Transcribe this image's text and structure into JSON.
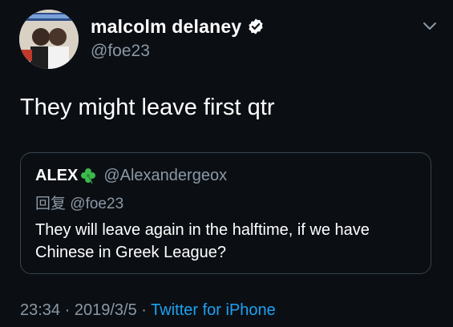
{
  "tweet": {
    "author": {
      "display_name": "malcolm delaney",
      "handle": "@foe23",
      "verified_icon": "verified-badge-icon"
    },
    "text": "They might leave first qtr",
    "quoted": {
      "author_name": "ALEX",
      "emoji_icon": "shamrock-icon",
      "author_handle": "@Alexandergeox",
      "reply_prefix": "回复",
      "reply_handle": "@foe23",
      "text": "They will leave again in the halftime, if we have Chinese in Greek League?"
    },
    "meta": {
      "time": "23:34",
      "separator": "·",
      "date": "2019/3/5",
      "source": "Twitter for iPhone"
    }
  },
  "colors": {
    "background": "#0b0f14",
    "secondary_text": "#8b98a5",
    "link": "#1da1f2",
    "border": "#38444d",
    "shamrock": "#3dba4e"
  }
}
